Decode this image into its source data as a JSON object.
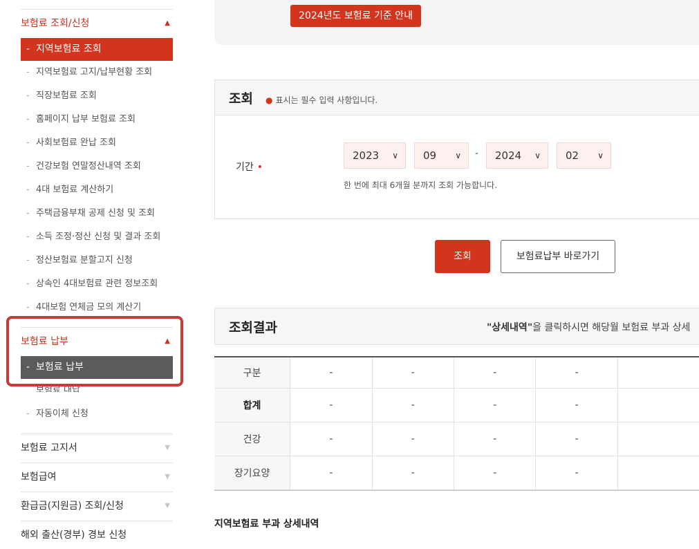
{
  "sidebar": {
    "sections": [
      {
        "label": "보험료 조회/신청",
        "state": "expanded",
        "items": [
          "지역보험료 조회",
          "지역보험료 고지/납부현황 조회",
          "직장보험료 조회",
          "홈페이지 납부 보험료 조회",
          "사회보험료 완납 조회",
          "건강보험 연말정산내역 조회",
          "4대 보험료 계산하기",
          "주택금융부채 공제 신청 및 조회",
          "소득 조정·정산 신청 및 결과 조회",
          "정산보험료 분할고지 신청",
          "상속인 4대보험료 관련 정보조회",
          "4대보험 연체금 모의 계산기"
        ],
        "selected_index": 0
      },
      {
        "label": "보험료 납부",
        "state": "expanded",
        "items": [
          "보험료 납부",
          "보험료 대납",
          "자동이체 신청"
        ],
        "selected_index": 0
      },
      {
        "label": "보험료 고지서",
        "state": "collapsed"
      },
      {
        "label": "보험급여",
        "state": "collapsed"
      },
      {
        "label": "환급금(지원금) 조회/신청",
        "state": "collapsed"
      },
      {
        "label": "해외 출산(경부) 경보 신청",
        "state": "collapsed"
      }
    ]
  },
  "main": {
    "notice_button": "2024년도 보험료 기준 안내",
    "query_panel": {
      "title": "조회",
      "required_note": "표시는 필수 입력 사항입니다.",
      "period_label": "기간",
      "from_year": "2023",
      "from_month": "09",
      "to_year": "2024",
      "to_month": "02",
      "range_separator": "-",
      "help_text": "한 번에 최대 6개월 분까지 조회 가능합니다."
    },
    "buttons": {
      "query": "조회",
      "payment_shortcut": "보험료납부 바로가기"
    },
    "result": {
      "title": "조회결과",
      "note_bold": "\"상세내역\"",
      "note_rest": "을 클릭하시면 해당월 보험료 부과 상세",
      "rows": [
        {
          "label": "구분",
          "bold": false,
          "cells": [
            "-",
            "-",
            "-",
            "-",
            ""
          ]
        },
        {
          "label": "합계",
          "bold": true,
          "cells": [
            "-",
            "-",
            "-",
            "-",
            ""
          ]
        },
        {
          "label": "건강",
          "bold": false,
          "cells": [
            "-",
            "-",
            "-",
            "-",
            ""
          ]
        },
        {
          "label": "장기요양",
          "bold": false,
          "cells": [
            "-",
            "-",
            "-",
            "-",
            ""
          ]
        }
      ]
    },
    "detail_title": "지역보험료 부과 상세내역"
  },
  "colors": {
    "accent": "#d2341e",
    "selected_gray": "#5b5b5b",
    "highlight": "#c93a3a"
  }
}
